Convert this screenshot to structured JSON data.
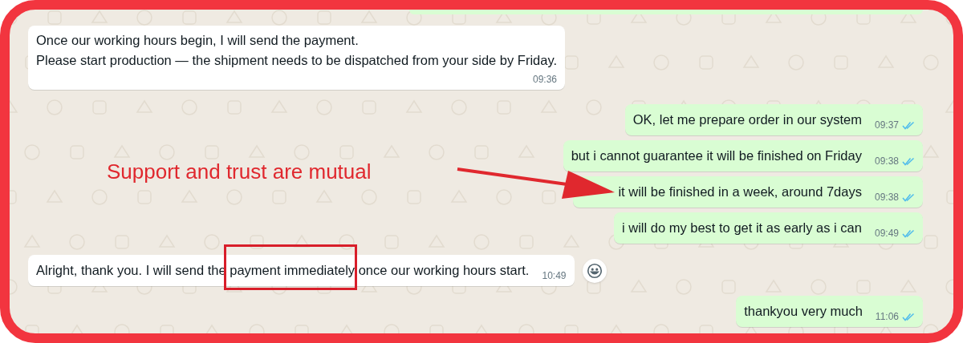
{
  "messages": [
    {
      "kind": "incoming",
      "lines": [
        "Once our working hours begin, I will send the payment.",
        "Please start production — the shipment needs to be dispatched from your side by Friday."
      ],
      "time": "09:36"
    },
    {
      "kind": "outgoing",
      "lines": [
        "OK, let me prepare order in our system"
      ],
      "time": "09:37",
      "read": true
    },
    {
      "kind": "outgoing",
      "lines": [
        "but i cannot guarantee it will be finished on Friday"
      ],
      "time": "09:38",
      "read": true
    },
    {
      "kind": "outgoing",
      "arrow_target": true,
      "lines": [
        "it will be finished in a week, around 7days"
      ],
      "time": "09:38",
      "read": true
    },
    {
      "kind": "outgoing",
      "lines": [
        "i will do my best to get it as early as i can"
      ],
      "time": "09:49",
      "read": true
    },
    {
      "kind": "incoming",
      "lines": [
        "Alright, thank you. I will send the payment immediately once our working hours start."
      ],
      "time": "10:49",
      "reaction_button": true
    },
    {
      "kind": "outgoing",
      "lines": [
        "thankyou very much"
      ],
      "time": "11:06",
      "read": true
    }
  ],
  "annotation": {
    "text": "Support and trust are mutual"
  }
}
